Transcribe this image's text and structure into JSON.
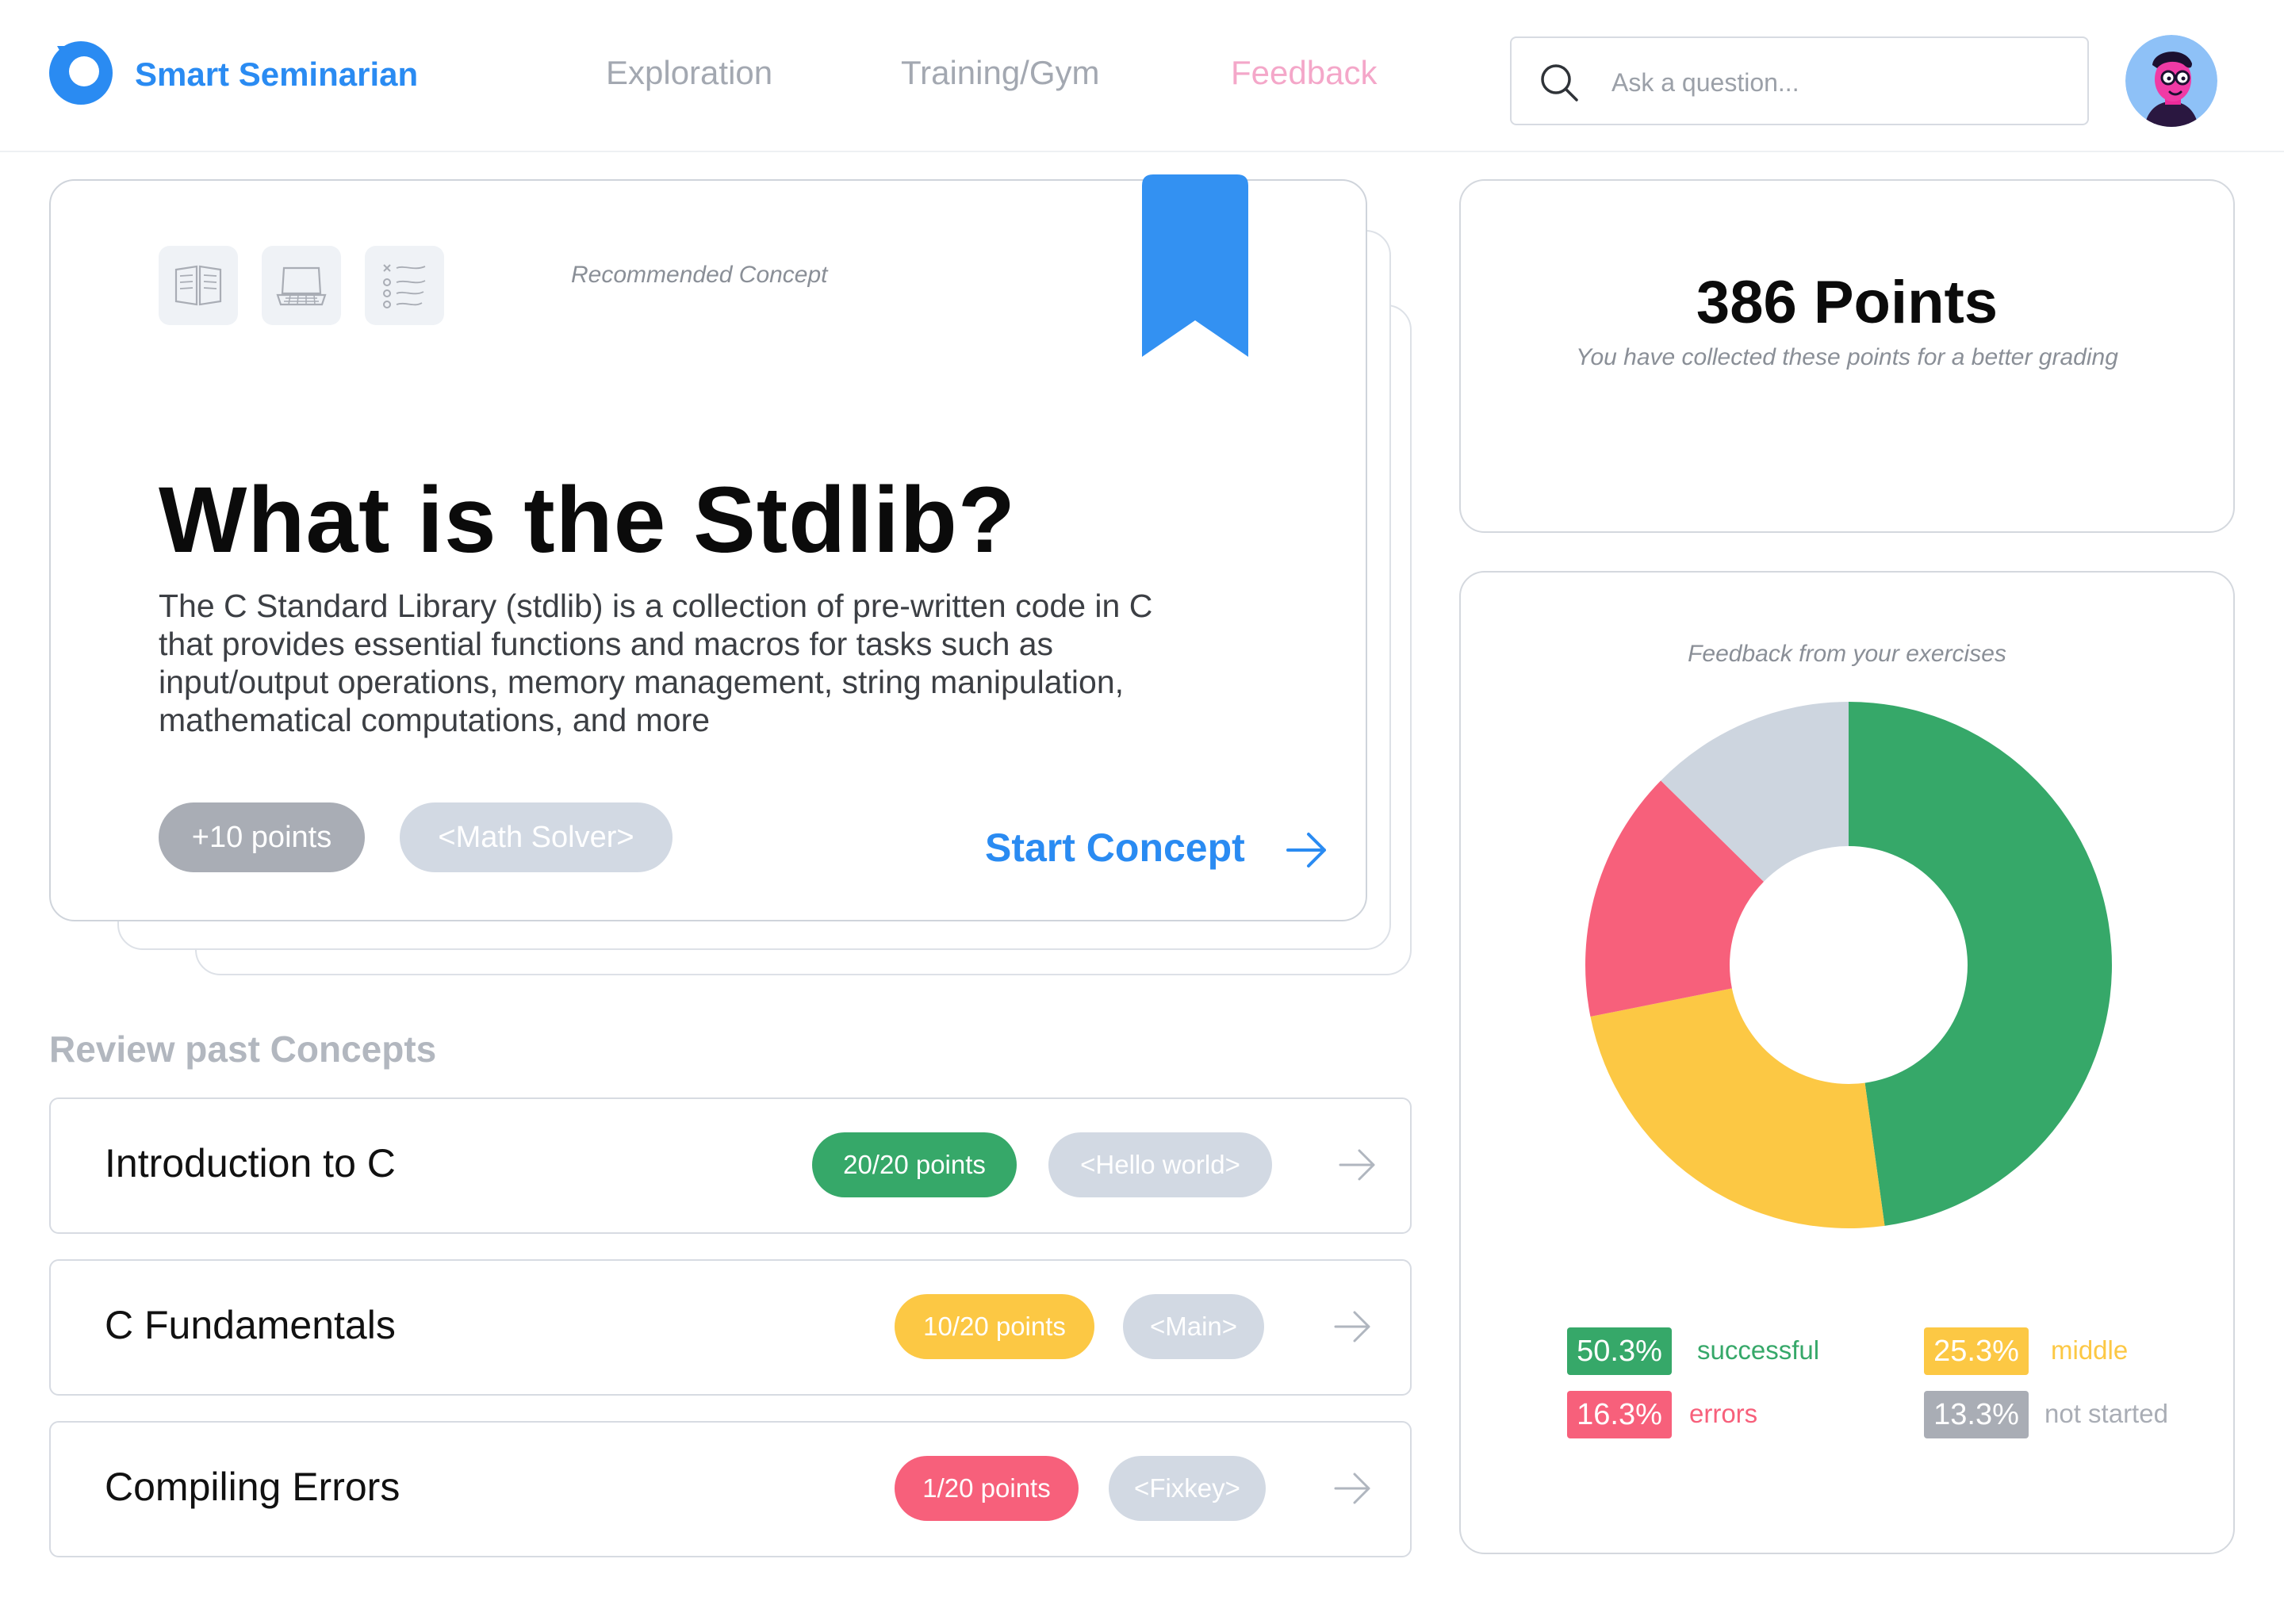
{
  "app": {
    "brand": "Smart Seminarian"
  },
  "nav": {
    "items": [
      {
        "label": "Exploration"
      },
      {
        "label": "Training/Gym"
      },
      {
        "label": "Feedback"
      }
    ]
  },
  "search": {
    "placeholder": "Ask a question..."
  },
  "recommended": {
    "caption": "Recommended Concept",
    "title": "What is the Stdlib?",
    "description": "The C Standard Library (stdlib) is a collection of pre-written code in C that provides essential functions and macros for tasks such as input/output operations, memory management, string manipulation, mathematical computations, and more",
    "points_badge": "+10 points",
    "tag": "<Math Solver>",
    "start_label": "Start Concept"
  },
  "review": {
    "heading": "Review past Concepts",
    "items": [
      {
        "name": "Introduction to C",
        "points": "20/20 points",
        "tag": "<Hello world>",
        "status_color": "#36a869"
      },
      {
        "name": "C Fundamentals",
        "points": "10/20 points",
        "tag": "<Main>",
        "status_color": "#fcc844"
      },
      {
        "name": "Compiling Errors",
        "points": "1/20 points",
        "tag": "<Fixkey>",
        "status_color": "#f7607b"
      }
    ]
  },
  "points": {
    "value": "386 Points",
    "subtitle": "You have collected these points for a better grading"
  },
  "feedback": {
    "title": "Feedback from your exercises"
  },
  "chart_data": {
    "type": "pie",
    "title": "Feedback from your exercises",
    "categories": [
      "successful",
      "middle",
      "errors",
      "not started"
    ],
    "values": [
      50.3,
      25.3,
      16.3,
      13.3
    ],
    "labels": [
      "50.3%",
      "25.3%",
      "16.3%",
      "13.3%"
    ],
    "colors": [
      "#36a869",
      "#fcc844",
      "#f7607b",
      "#cdd5df"
    ],
    "label_colors": [
      "#36a869",
      "#fcc844",
      "#f7607b",
      "#a9adb5"
    ],
    "badge_colors": [
      "#36a869",
      "#fcc844",
      "#f7607b",
      "#a9adb5"
    ],
    "donut": true,
    "legend_position": "bottom"
  },
  "colors": {
    "accent": "#2a8bf2",
    "nav_active": "#f4a7c9",
    "success": "#36a869",
    "warning": "#fcc844",
    "error": "#f7607b",
    "neutral": "#d2d9e3"
  }
}
